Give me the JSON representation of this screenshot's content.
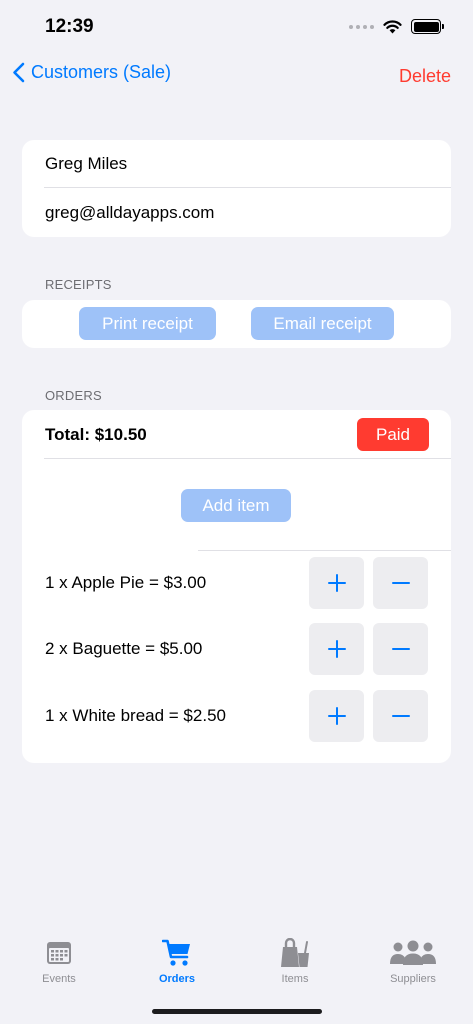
{
  "status_bar": {
    "time": "12:39"
  },
  "nav": {
    "back_label": "Customers (Sale)",
    "delete_label": "Delete"
  },
  "customer": {
    "name": "Greg Miles",
    "email": "greg@alldayapps.com"
  },
  "receipts": {
    "section_label": "RECEIPTS",
    "print_label": "Print receipt",
    "email_label": "Email receipt"
  },
  "orders": {
    "section_label": "ORDERS",
    "total": "Total: $10.50",
    "status": "Paid",
    "add_item_label": "Add item",
    "items": [
      {
        "label": "1 x Apple Pie = $3.00"
      },
      {
        "label": "2 x Baguette = $5.00"
      },
      {
        "label": "1 x White bread = $2.50"
      }
    ]
  },
  "tabs": [
    {
      "label": "Events",
      "icon": "calendar-icon",
      "active": false
    },
    {
      "label": "Orders",
      "icon": "cart-icon",
      "active": true
    },
    {
      "label": "Items",
      "icon": "bag-icon",
      "active": false
    },
    {
      "label": "Suppliers",
      "icon": "people-icon",
      "active": false
    }
  ],
  "colors": {
    "accent": "#007aff",
    "destructive": "#ff3b30",
    "disabled_button": "#9ec2f8",
    "background": "#f2f2f7"
  }
}
